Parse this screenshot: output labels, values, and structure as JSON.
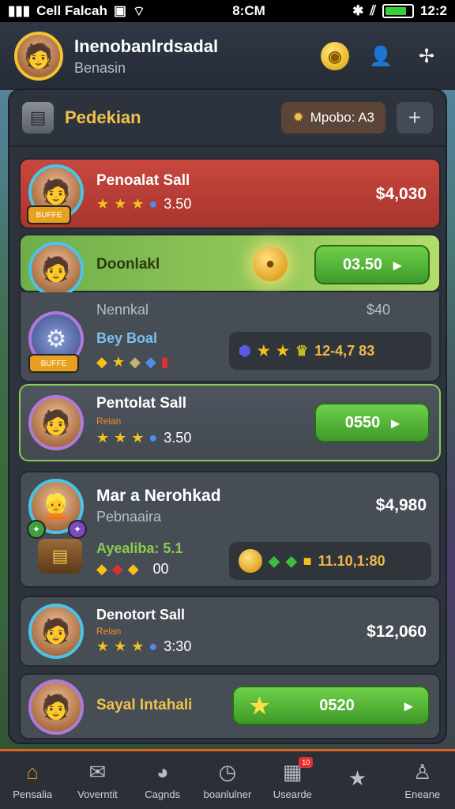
{
  "status_bar": {
    "carrier": "Cell Falcah",
    "time": "8:CM",
    "right_time": "12:2",
    "battery_level": 0.8
  },
  "header": {
    "title": "Inenobanlrdsadal",
    "subtitle": "Benasin"
  },
  "panel": {
    "title": "Pedekian",
    "filter_label": "Mpobo: A3",
    "add_label": "+"
  },
  "cards": [
    {
      "name": "Penoalat Sall",
      "rating": "3.50",
      "price": "$4,030",
      "badge_text": "BUFFE"
    },
    {
      "name": "Doonlakl",
      "button_value": "03.50",
      "sub_label": "Nennkal",
      "sub_value": "$40"
    },
    {
      "name": "Bey Boal",
      "badge_text": "BUFFE",
      "strip_value": "12-4,7 83"
    },
    {
      "name": "Pentolat Sall",
      "tag": "Relan",
      "rating": "3.50",
      "button_value": "0550"
    },
    {
      "name": "Mar a Nerohkad",
      "sub": "Pebnaaira",
      "price": "$4,980",
      "tag": "Ayealiba: 5.1",
      "tag_value": "00",
      "strip_value": "11.10,1:80"
    },
    {
      "name": "Denotort Sall",
      "tag": "Relan",
      "rating": "3:30",
      "price": "$12,060"
    },
    {
      "name": "Sayal Intahali",
      "button_value": "0520"
    }
  ],
  "nav": [
    {
      "label": "Pensalia",
      "icon": "home-icon"
    },
    {
      "label": "Voverntit",
      "icon": "cards-icon"
    },
    {
      "label": "Cagnds",
      "icon": "palette-icon"
    },
    {
      "label": "boanlulner",
      "icon": "clock-icon"
    },
    {
      "label": "Usearde",
      "icon": "grid-icon",
      "badge": "10"
    },
    {
      "label": "",
      "icon": "star-icon"
    },
    {
      "label": "Eneane",
      "icon": "profile-icon"
    }
  ]
}
